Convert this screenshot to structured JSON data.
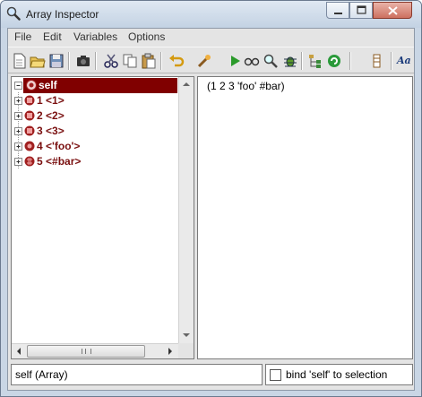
{
  "window": {
    "title": "Array Inspector",
    "icon": "magnifier-icon"
  },
  "menu": {
    "items": [
      "File",
      "Edit",
      "Variables",
      "Options"
    ]
  },
  "toolbar": {
    "icons": [
      "new-file-icon",
      "open-folder-icon",
      "save-icon",
      "camera-icon",
      "cut-icon",
      "copy-icon",
      "paste-icon",
      "undo-icon",
      "inspect-wand-icon",
      "run-icon",
      "glasses-icon",
      "search-icon",
      "bug-icon",
      "tree-icon",
      "refresh-icon",
      "columns-icon",
      "font-icon"
    ],
    "font_label": "Aa"
  },
  "tree": {
    "root": {
      "label": "self",
      "icon": "object-icon"
    },
    "items": [
      {
        "label": "1 <1>",
        "icon": "integer-icon"
      },
      {
        "label": "2 <2>",
        "icon": "integer-icon"
      },
      {
        "label": "3 <3>",
        "icon": "integer-icon"
      },
      {
        "label": "4 <'foo'>",
        "icon": "string-icon"
      },
      {
        "label": "5 <#bar>",
        "icon": "symbol-icon"
      }
    ]
  },
  "value_pane": {
    "text": "(1 2 3 'foo' #bar)"
  },
  "status": {
    "text": "self (Array)"
  },
  "bind": {
    "label": "bind 'self' to selection",
    "checked": false
  },
  "colors": {
    "selection": "#800000",
    "node_label": "#7a1010",
    "title_bar": "#c9d6e5"
  }
}
